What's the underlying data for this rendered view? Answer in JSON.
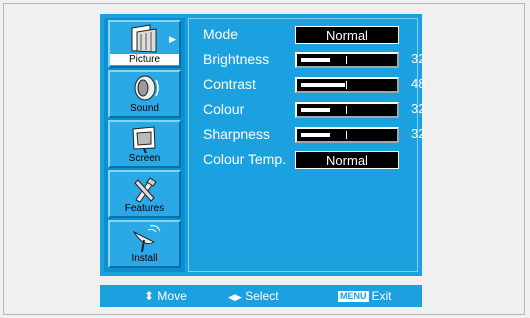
{
  "categories": [
    {
      "label": "Picture",
      "icon": "picture-icon",
      "active": true
    },
    {
      "label": "Sound",
      "icon": "speaker-icon"
    },
    {
      "label": "Screen",
      "icon": "screen-icon"
    },
    {
      "label": "Features",
      "icon": "tools-icon"
    },
    {
      "label": "Install",
      "icon": "satellite-dish-icon"
    }
  ],
  "settings": {
    "mode": {
      "label": "Mode",
      "value": "Normal"
    },
    "brightness": {
      "label": "Brightness",
      "value": 32
    },
    "contrast": {
      "label": "Contrast",
      "value": 48
    },
    "colour": {
      "label": "Colour",
      "value": 32
    },
    "sharpness": {
      "label": "Sharpness",
      "value": 32
    },
    "colour_temp": {
      "label": "Colour Temp.",
      "value": "Normal"
    }
  },
  "footer": {
    "move": "Move",
    "select": "Select",
    "menu_key": "MENU",
    "exit": "Exit"
  },
  "colors": {
    "menu_bg": "#1ca1e0",
    "sidebar_bg": "#0a8fd0",
    "page_bg": "#f0f0f0"
  }
}
